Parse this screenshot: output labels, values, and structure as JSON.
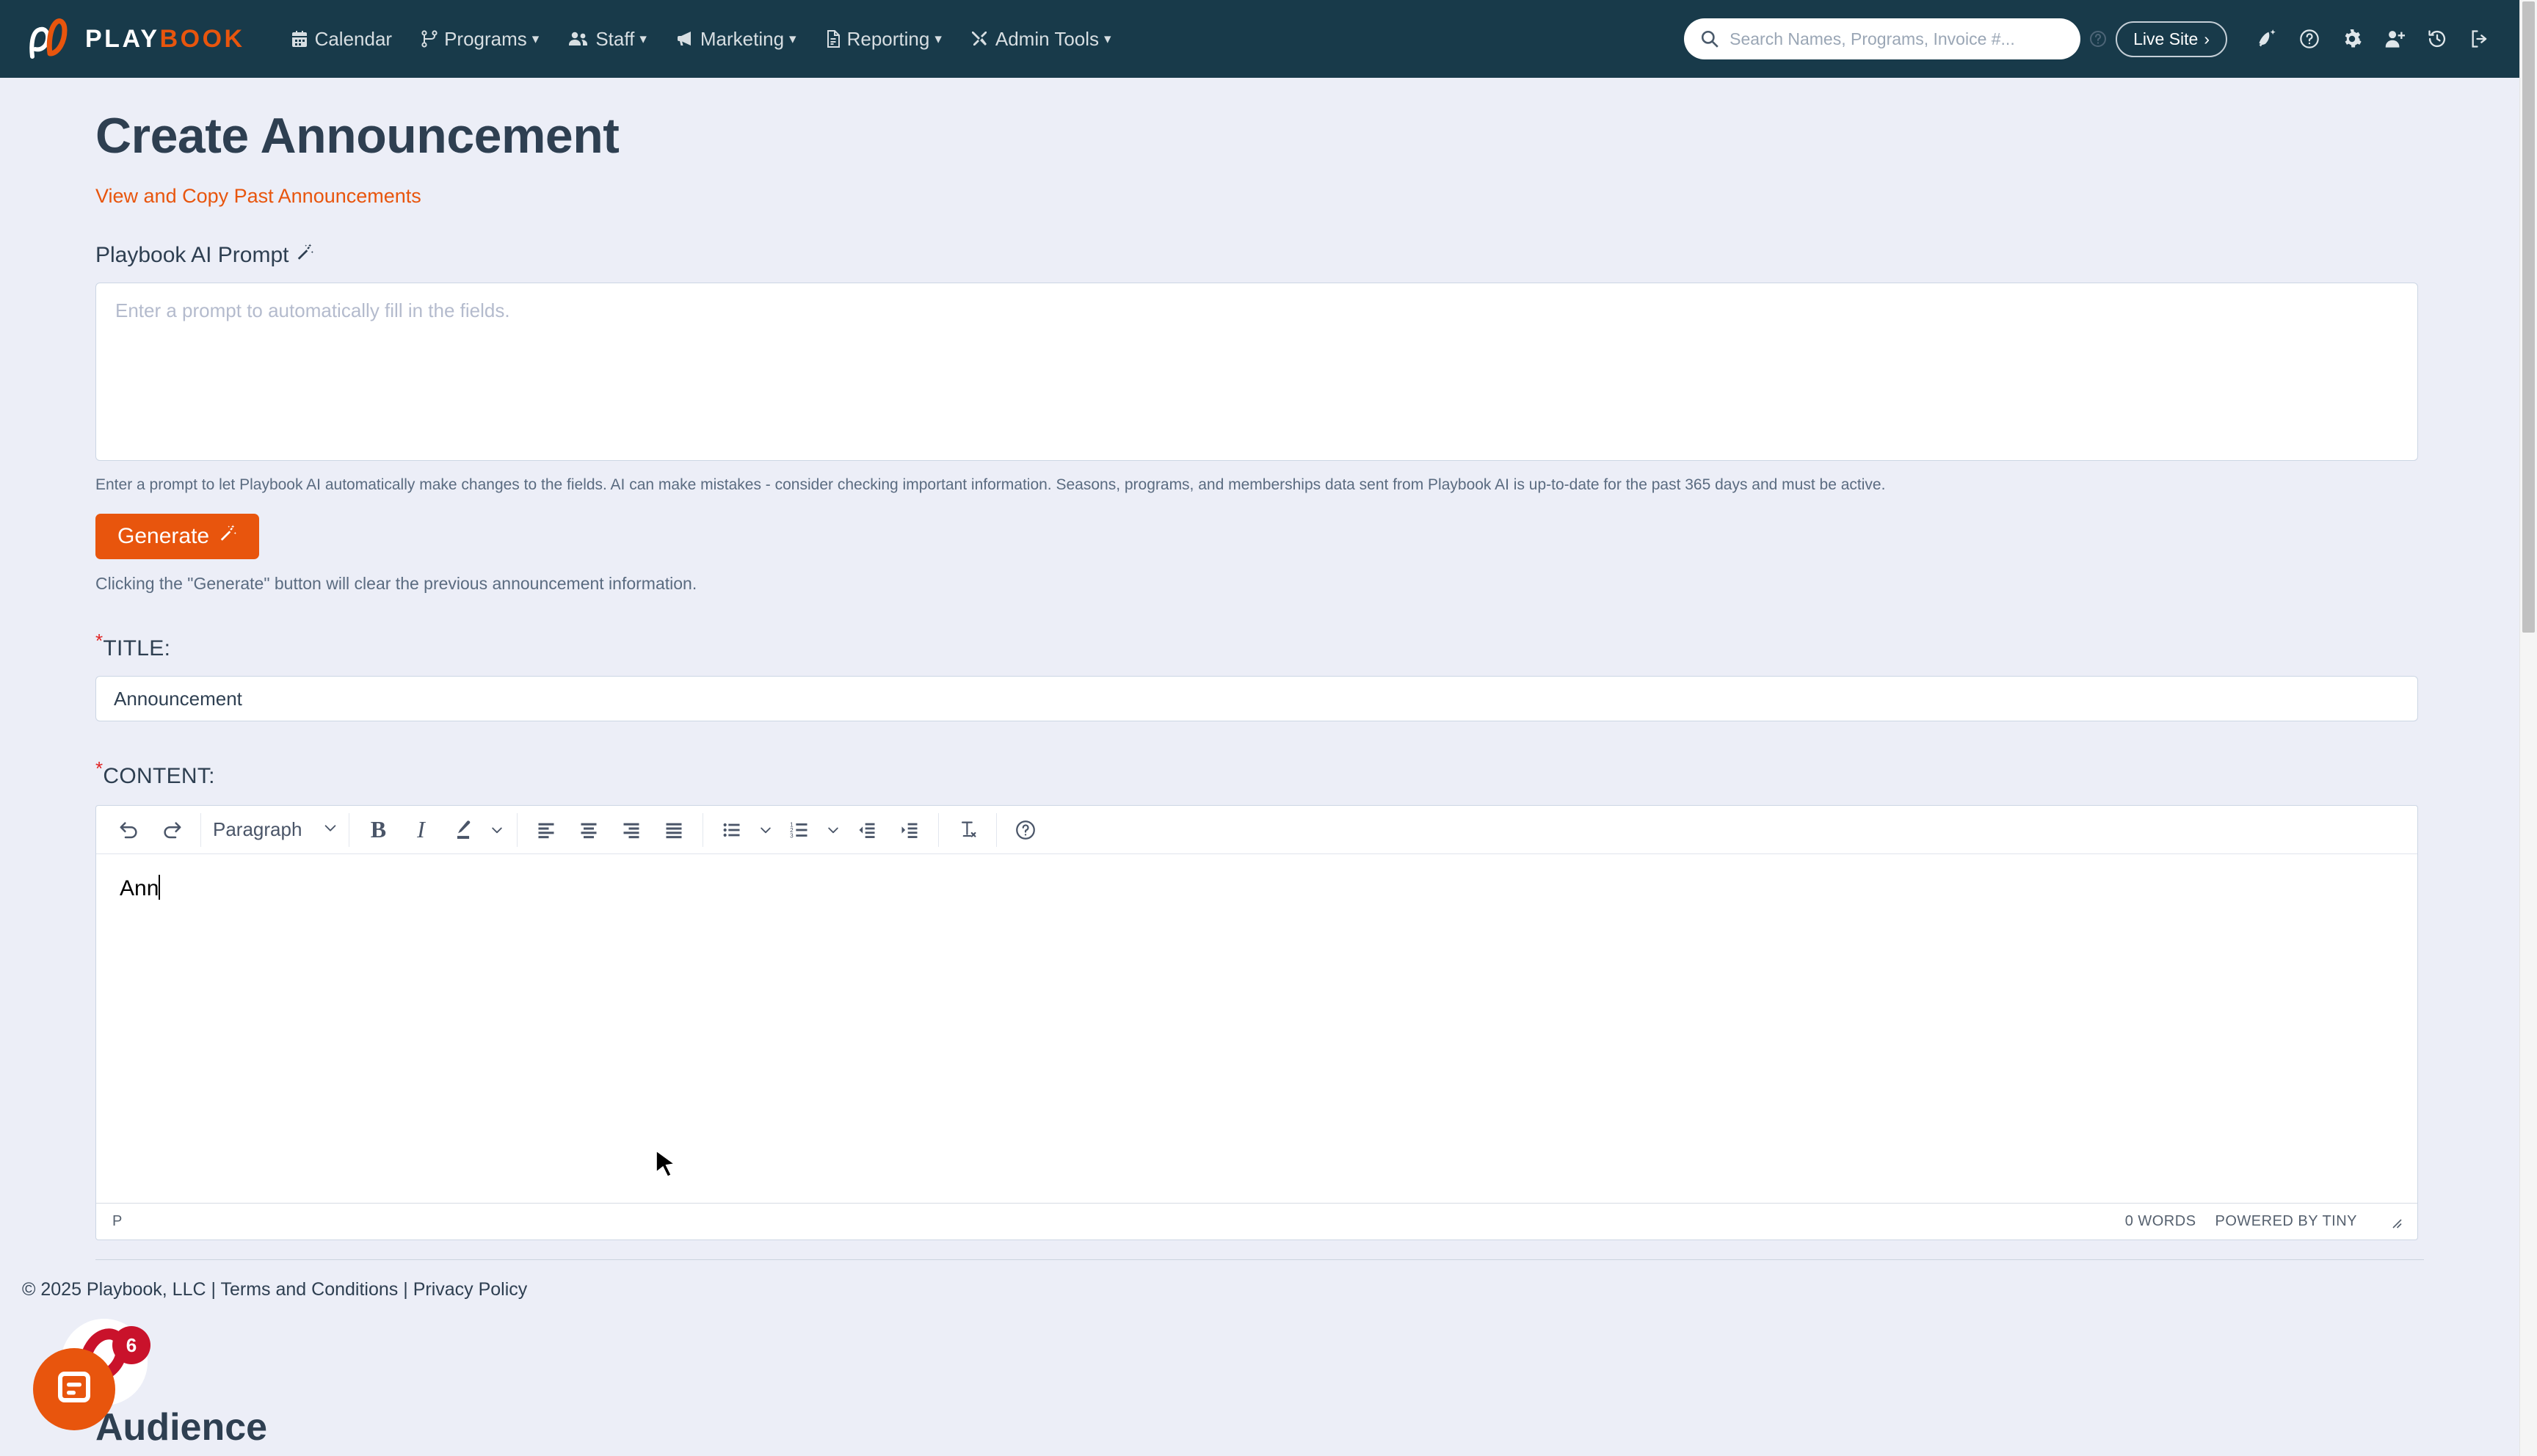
{
  "navbar": {
    "brand": {
      "play": "PLAY",
      "book": "BOOK"
    },
    "items": [
      {
        "label": "Calendar",
        "icon": "calendar-icon",
        "caret": false
      },
      {
        "label": "Programs",
        "icon": "sitemap-icon",
        "caret": true
      },
      {
        "label": "Staff",
        "icon": "users-icon",
        "caret": true
      },
      {
        "label": "Marketing",
        "icon": "megaphone-icon",
        "caret": true
      },
      {
        "label": "Reporting",
        "icon": "document-icon",
        "caret": true
      },
      {
        "label": "Admin Tools",
        "icon": "tools-icon",
        "caret": true
      }
    ],
    "search": {
      "placeholder": "Search Names, Programs, Invoice #...",
      "value": ""
    },
    "search_help_icon": "question-circle-icon",
    "live_site": {
      "label": "Live Site",
      "chevron": "›"
    },
    "icons": [
      {
        "name": "rocket-add-icon"
      },
      {
        "name": "help-circle-icon"
      },
      {
        "name": "gear-icon"
      },
      {
        "name": "user-add-icon"
      },
      {
        "name": "history-icon"
      },
      {
        "name": "logout-icon"
      }
    ],
    "colors": {
      "bg": "#183a4a",
      "accent": "#e8550d"
    }
  },
  "page": {
    "title": "Create Announcement",
    "past_announcements_link": "View and Copy Past Announcements",
    "ai_prompt": {
      "label": "Playbook AI Prompt",
      "label_icon": "magic-wand-icon",
      "placeholder": "Enter a prompt to automatically fill in the fields.",
      "value": "",
      "helper": "Enter a prompt to let Playbook AI automatically make changes to the fields. AI can make mistakes - consider checking important information. Seasons, programs, and memberships data sent from Playbook AI is up-to-date for the past 365 days and must be active.",
      "generate_label": "Generate",
      "generate_icon": "magic-wand-icon",
      "generate_note": "Clicking the \"Generate\" button will clear the previous announcement information."
    },
    "title_field": {
      "required_marker": "*",
      "label": "TITLE:",
      "value": "Announcement",
      "placeholder": ""
    },
    "content_field": {
      "required_marker": "*",
      "label": "CONTENT:",
      "body_text": "Ann"
    },
    "audience_heading": "Audience"
  },
  "editor": {
    "toolbar": {
      "undo": "undo-icon",
      "redo": "redo-icon",
      "block_format": "Paragraph",
      "bold": "B",
      "italic": "I",
      "text_color": "text-color-icon",
      "align_left": "align-left-icon",
      "align_center": "align-center-icon",
      "align_right": "align-right-icon",
      "align_justify": "align-justify-icon",
      "bullet_list": "bullet-list-icon",
      "numbered_list": "numbered-list-icon",
      "outdent": "outdent-icon",
      "indent": "indent-icon",
      "clear_formatting": "clear-formatting-icon",
      "help": "help-icon"
    },
    "status": {
      "path": "P",
      "word_count": "0 WORDS",
      "branding": "POWERED BY TINY"
    }
  },
  "footer": {
    "copyright": "© 2025 Playbook, LLC",
    "sep1": "|",
    "terms": "Terms and Conditions",
    "sep2": "|",
    "privacy": "Privacy Policy"
  },
  "chat": {
    "badge_count": "6",
    "icon": "chat-bubble-icon"
  }
}
